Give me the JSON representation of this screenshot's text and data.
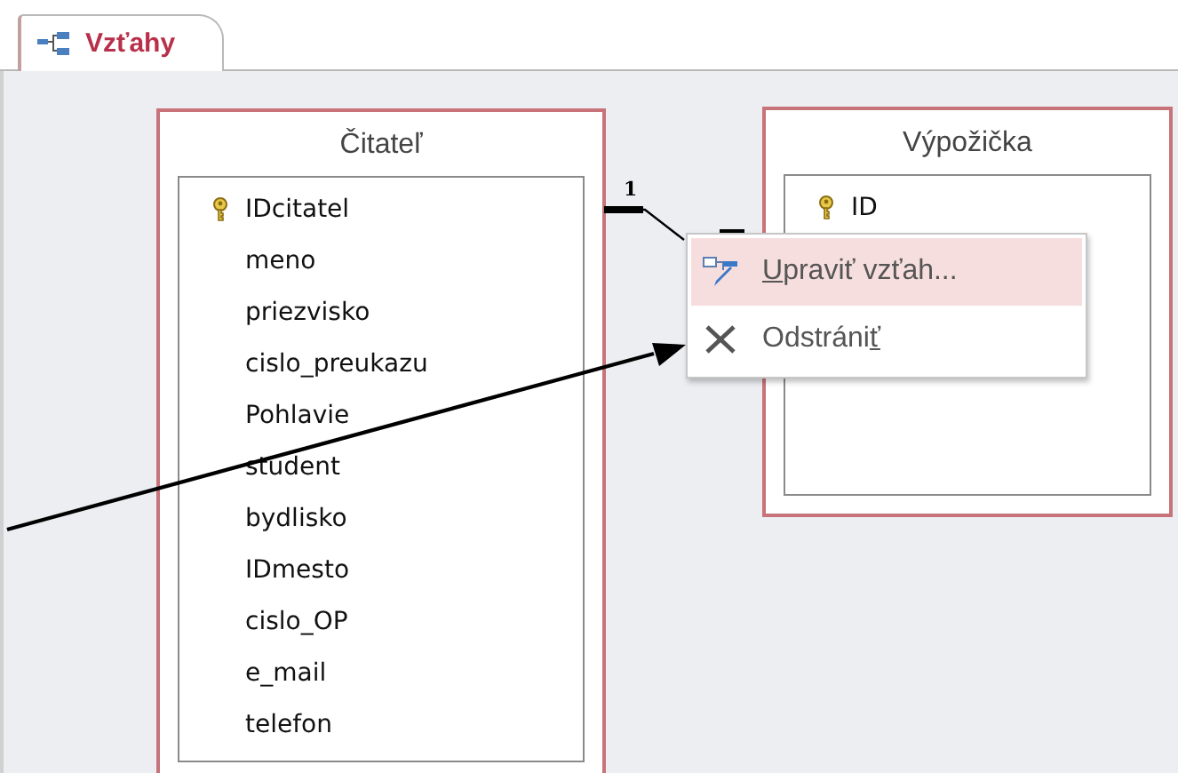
{
  "tabs": [
    {
      "label": "Vzťahy",
      "selected": true
    }
  ],
  "tables": [
    {
      "title": "Čitateľ",
      "fields": [
        {
          "name": "IDcitatel",
          "primary_key": true
        },
        {
          "name": "meno",
          "primary_key": false
        },
        {
          "name": "priezvisko",
          "primary_key": false
        },
        {
          "name": "cislo_preukazu",
          "primary_key": false
        },
        {
          "name": "Pohlavie",
          "primary_key": false
        },
        {
          "name": "student",
          "primary_key": false
        },
        {
          "name": "bydlisko",
          "primary_key": false
        },
        {
          "name": "IDmesto",
          "primary_key": false
        },
        {
          "name": "cislo_OP",
          "primary_key": false
        },
        {
          "name": "e_mail",
          "primary_key": false
        },
        {
          "name": "telefon",
          "primary_key": false
        }
      ]
    },
    {
      "title": "Výpožička",
      "fields": [
        {
          "name": "ID",
          "primary_key": true
        }
      ]
    }
  ],
  "relationship": {
    "one_label": "1"
  },
  "context_menu": [
    {
      "kind": "edit",
      "accel": "U",
      "after": "praviť vzťah...",
      "selected": true
    },
    {
      "kind": "delete",
      "before": "Odstráni",
      "accel": "ť",
      "selected": false
    }
  ]
}
